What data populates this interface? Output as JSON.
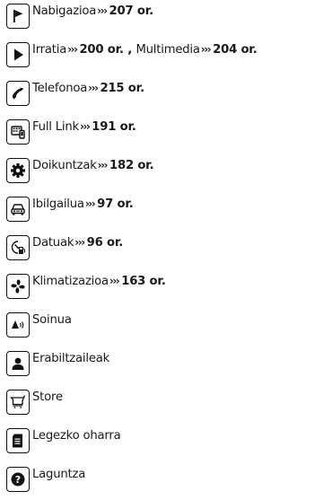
{
  "menu": {
    "items": [
      {
        "label": "Nabigazioa",
        "sep": "›››",
        "ref": "207 or.",
        "icon": "flag-icon"
      },
      {
        "label": "Irratia",
        "sep": "›››",
        "ref": "200 or.",
        "mid": " , ",
        "label2": "Multimedia",
        "sep2": "›››",
        "ref2": "204 or.",
        "icon": "play-icon"
      },
      {
        "label": "Telefonoa",
        "sep": "›››",
        "ref": "215 or.",
        "icon": "phone-icon"
      },
      {
        "label": "Full Link",
        "sep": "›››",
        "ref": "191 or.",
        "icon": "full-link-icon"
      },
      {
        "label": "Doikuntzak",
        "sep": "›››",
        "ref": "182 or.",
        "icon": "gear-icon"
      },
      {
        "label": "Ibilgailua",
        "sep": "›››",
        "ref": "97 or.",
        "icon": "car-icon"
      },
      {
        "label": "Datuak",
        "sep": "›››",
        "ref": "96 or.",
        "icon": "fuel-data-icon"
      },
      {
        "label": "Klimatizazioa",
        "sep": "›››",
        "ref": "163 or.",
        "icon": "fan-icon"
      },
      {
        "label": "Soinua",
        "icon": "speaker-icon"
      },
      {
        "label": "Erabiltzaileak",
        "icon": "user-icon"
      },
      {
        "label": "Store",
        "icon": "cart-icon"
      },
      {
        "label": "Legezko oharra",
        "icon": "document-icon"
      },
      {
        "label": "Laguntza",
        "icon": "help-icon"
      }
    ]
  }
}
